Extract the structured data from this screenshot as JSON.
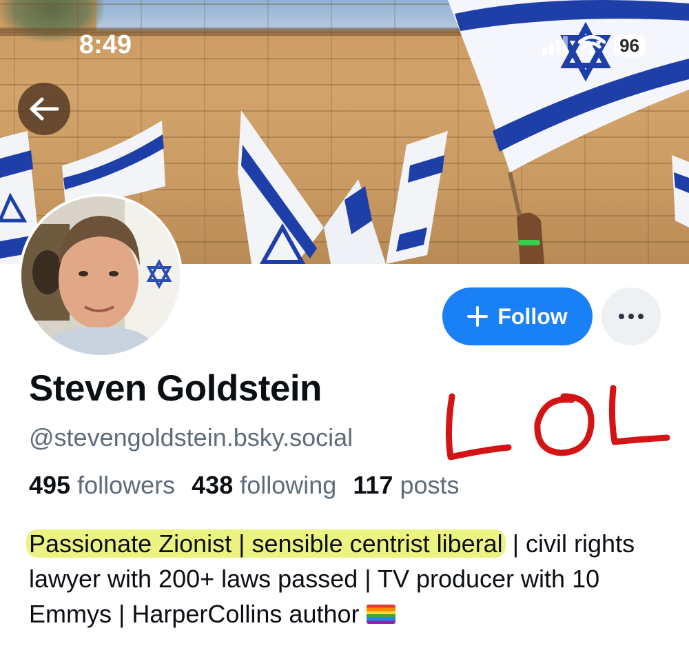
{
  "status_bar": {
    "time": "8:49",
    "battery": "96"
  },
  "banner": {
    "icon": "flag-of-israel-banner"
  },
  "actions": {
    "follow_label": "Follow",
    "more_icon": "ellipsis-icon"
  },
  "profile": {
    "display_name": "Steven Goldstein",
    "handle": "@stevengoldstein.bsky.social",
    "stats": {
      "followers_count": "495",
      "followers_label": "followers",
      "following_count": "438",
      "following_label": "following",
      "posts_count": "117",
      "posts_label": "posts"
    },
    "bio": {
      "highlighted": "Passionate Zionist | sensible centrist liberal",
      "rest": " | civil rights lawyer with 200+ laws passed | TV producer with 10 Emmys | HarperCollins author "
    }
  },
  "annotation": {
    "handwritten_text": "LOL",
    "color": "#d41414"
  },
  "colors": {
    "accent": "#1a80f5",
    "highlight": "#e4f05a"
  }
}
